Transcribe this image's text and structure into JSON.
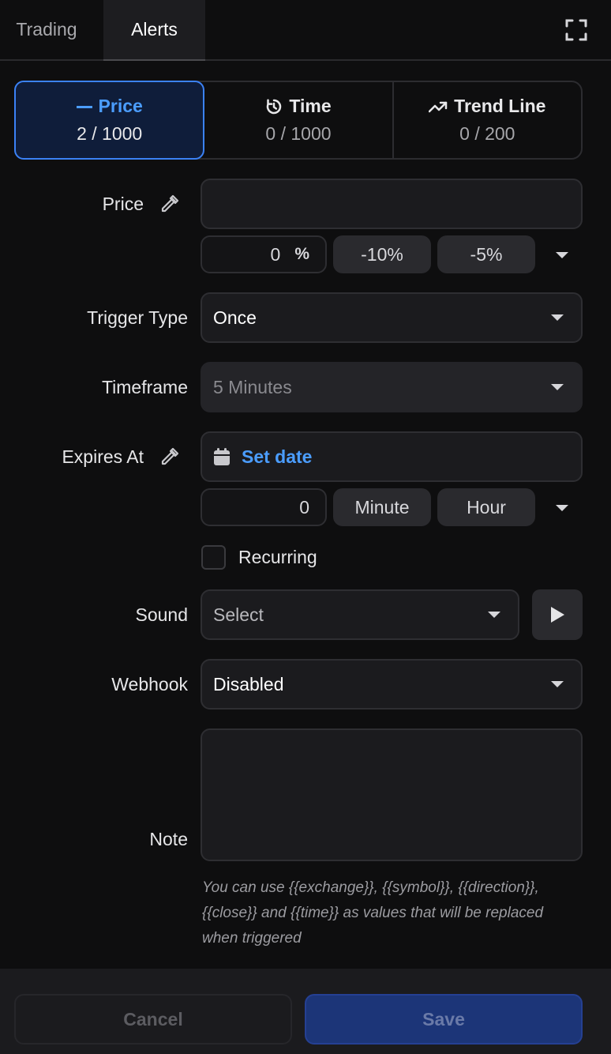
{
  "tabs": {
    "trading": "Trading",
    "alerts": "Alerts",
    "active": "Alerts"
  },
  "types": [
    {
      "label": "Price",
      "count": "2 / 1000",
      "icon": "dash-icon",
      "active": true
    },
    {
      "label": "Time",
      "count": "0 / 1000",
      "icon": "timer-icon",
      "active": false
    },
    {
      "label": "Trend Line",
      "count": "0 / 200",
      "icon": "trend-up-icon",
      "active": false
    }
  ],
  "price": {
    "label": "Price",
    "value": "",
    "percent_value": "0",
    "percent_symbol": "%",
    "presets": [
      "-10%",
      "-5%"
    ]
  },
  "trigger_type": {
    "label": "Trigger Type",
    "value": "Once"
  },
  "timeframe": {
    "label": "Timeframe",
    "value": "5 Minutes"
  },
  "expires": {
    "label": "Expires At",
    "set_date": "Set date",
    "offset_value": "0",
    "units": [
      "Minute",
      "Hour"
    ]
  },
  "recurring": {
    "label": "Recurring",
    "checked": false
  },
  "sound": {
    "label": "Sound",
    "value": "Select"
  },
  "webhook": {
    "label": "Webhook",
    "value": "Disabled"
  },
  "note": {
    "label": "Note",
    "value": "",
    "hint": "You can use {{exchange}}, {{symbol}}, {{direction}}, {{close}} and {{time}} as values that will be replaced when triggered"
  },
  "footer": {
    "cancel": "Cancel",
    "save": "Save"
  },
  "colors": {
    "accent": "#3b82f6",
    "accent_text": "#4b9dff",
    "save_bg": "#1c3578",
    "background": "#0e0e0f"
  }
}
